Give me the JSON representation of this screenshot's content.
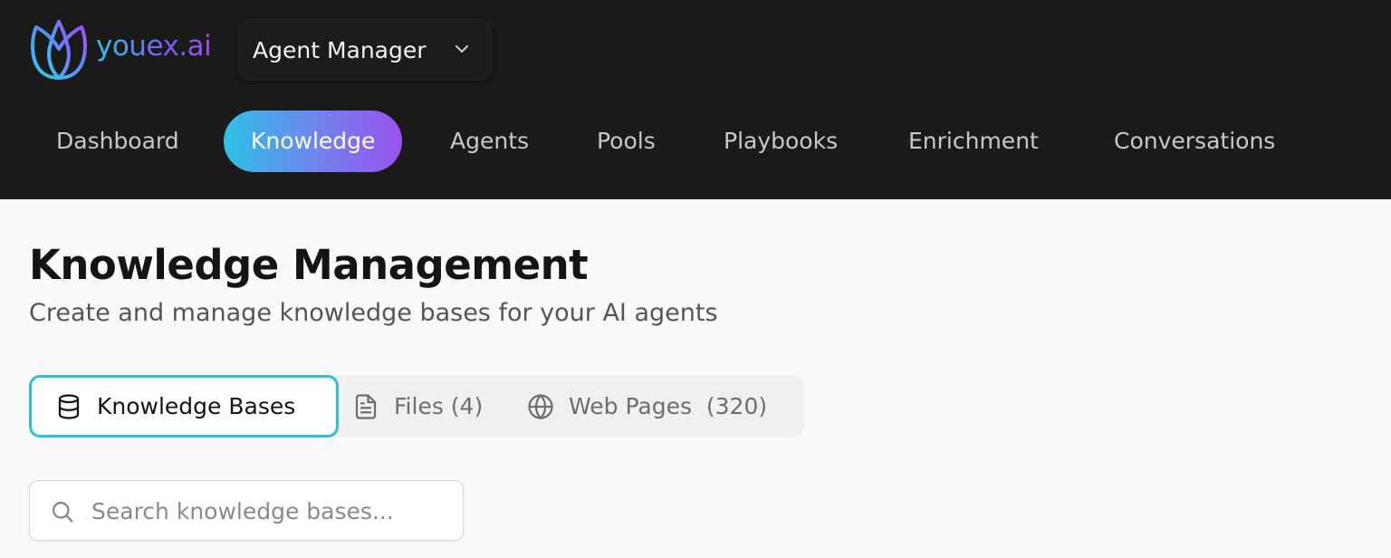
{
  "brand": {
    "name": "youex.ai",
    "logo_icon": "tulip-logo-icon",
    "gradient": [
      "#31c6ea",
      "#a04ff2"
    ]
  },
  "app_switcher": {
    "label": "Agent Manager",
    "icon": "chevron-down-icon"
  },
  "nav": {
    "items": [
      {
        "label": "Dashboard",
        "active": false
      },
      {
        "label": "Knowledge",
        "active": true
      },
      {
        "label": "Agents",
        "active": false
      },
      {
        "label": "Pools",
        "active": false
      },
      {
        "label": "Playbooks",
        "active": false
      },
      {
        "label": "Enrichment",
        "active": false
      },
      {
        "label": "Conversations",
        "active": false
      }
    ]
  },
  "page": {
    "title": "Knowledge Management",
    "subtitle": "Create and manage knowledge bases for your AI agents"
  },
  "tabs": [
    {
      "label": "Knowledge Bases",
      "icon": "database-icon",
      "active": true
    },
    {
      "label": "Files (4)",
      "icon": "file-icon",
      "active": false
    },
    {
      "label": "Web Pages  (320)",
      "icon": "globe-icon",
      "active": false
    }
  ],
  "search": {
    "placeholder": "Search knowledge bases...",
    "value": "",
    "icon": "search-icon"
  },
  "colors": {
    "topbar_bg": "#1a1a1a",
    "accent_teal": "#2ec0d6",
    "page_bg": "#fafafa"
  }
}
